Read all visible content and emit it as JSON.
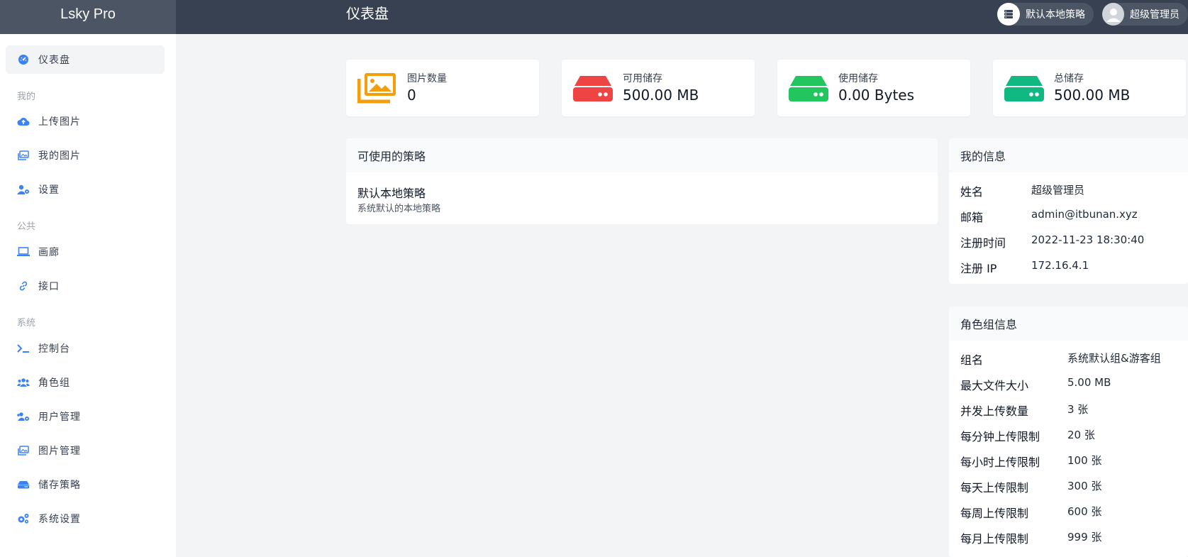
{
  "app": {
    "brand": "Lsky Pro",
    "page_title": "仪表盘"
  },
  "header": {
    "policy_label": "默认本地策略",
    "user_label": "超级管理员"
  },
  "sidebar": {
    "items": [
      {
        "label": "仪表盘"
      },
      {
        "section": "我的"
      },
      {
        "label": "上传图片"
      },
      {
        "label": "我的图片"
      },
      {
        "label": "设置"
      },
      {
        "section": "公共"
      },
      {
        "label": "画廊"
      },
      {
        "label": "接口"
      },
      {
        "section": "系统"
      },
      {
        "label": "控制台"
      },
      {
        "label": "角色组"
      },
      {
        "label": "用户管理"
      },
      {
        "label": "图片管理"
      },
      {
        "label": "储存策略"
      },
      {
        "label": "系统设置"
      }
    ]
  },
  "stats": [
    {
      "label": "图片数量",
      "value": "0",
      "color": "#f59e0b"
    },
    {
      "label": "可用储存",
      "value": "500.00 MB",
      "color": "#ef4444"
    },
    {
      "label": "使用储存",
      "value": "0.00 Bytes",
      "color": "#22c55e"
    },
    {
      "label": "总储存",
      "value": "500.00 MB",
      "color": "#10b981"
    }
  ],
  "policies": {
    "title": "可使用的策略",
    "items": [
      {
        "name": "默认本地策略",
        "desc": "系统默认的本地策略"
      }
    ]
  },
  "my_info": {
    "title": "我的信息",
    "rows": [
      {
        "k": "姓名",
        "v": "超级管理员"
      },
      {
        "k": "邮箱",
        "v": "admin@itbunan.xyz"
      },
      {
        "k": "注册时间",
        "v": "2022-11-23 18:30:40"
      },
      {
        "k": "注册 IP",
        "v": "172.16.4.1"
      }
    ]
  },
  "role_info": {
    "title": "角色组信息",
    "rows": [
      {
        "k": "组名",
        "v": "系统默认组&游客组"
      },
      {
        "k": "最大文件大小",
        "v": "5.00 MB"
      },
      {
        "k": "并发上传数量",
        "v": "3 张"
      },
      {
        "k": "每分钟上传限制",
        "v": "20 张"
      },
      {
        "k": "每小时上传限制",
        "v": "100 张"
      },
      {
        "k": "每天上传限制",
        "v": "300 张"
      },
      {
        "k": "每周上传限制",
        "v": "600 张"
      },
      {
        "k": "每月上传限制",
        "v": "999 张"
      }
    ]
  },
  "colors": {
    "accent": "#3b82f6",
    "topbar": "#374151"
  }
}
